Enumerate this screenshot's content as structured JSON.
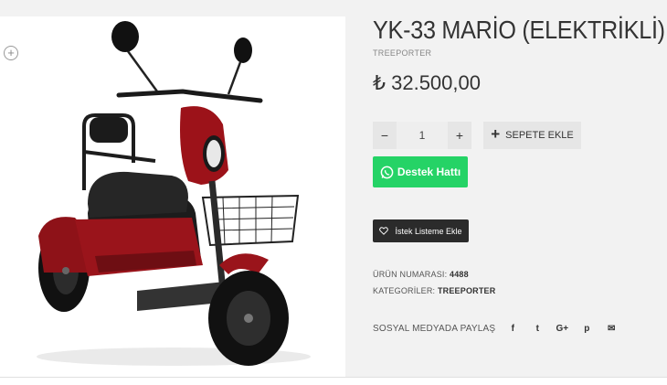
{
  "product": {
    "title": "YK-33 MARİO (ELEKTRİKLİ)",
    "brand": "TREEPORTER",
    "price": "₺ 32.500,00",
    "image_icon": "zoom-plus-icon"
  },
  "cart": {
    "minus": "−",
    "plus": "+",
    "quantity": "1",
    "add_to_cart": "SEPETE EKLE",
    "add_icon": "plus-icon"
  },
  "support": {
    "label": "Destek Hattı",
    "icon": "whatsapp-icon",
    "color": "#25d366"
  },
  "wishlist": {
    "label": "İstek Listeme Ekle",
    "icon": "heart-icon"
  },
  "meta": {
    "sku_label": "ÜRÜN NUMARASI:",
    "sku_value": "4488",
    "category_label": "KATEGORİLER:",
    "category_value": "TREEPORTER"
  },
  "share": {
    "label": "SOSYAL MEDYADA PAYLAŞ",
    "icons": [
      "facebook-icon",
      "twitter-icon",
      "google-plus-icon",
      "pinterest-icon",
      "email-icon"
    ],
    "glyphs": [
      "f",
      "t",
      "G+",
      "p",
      "✉"
    ]
  }
}
